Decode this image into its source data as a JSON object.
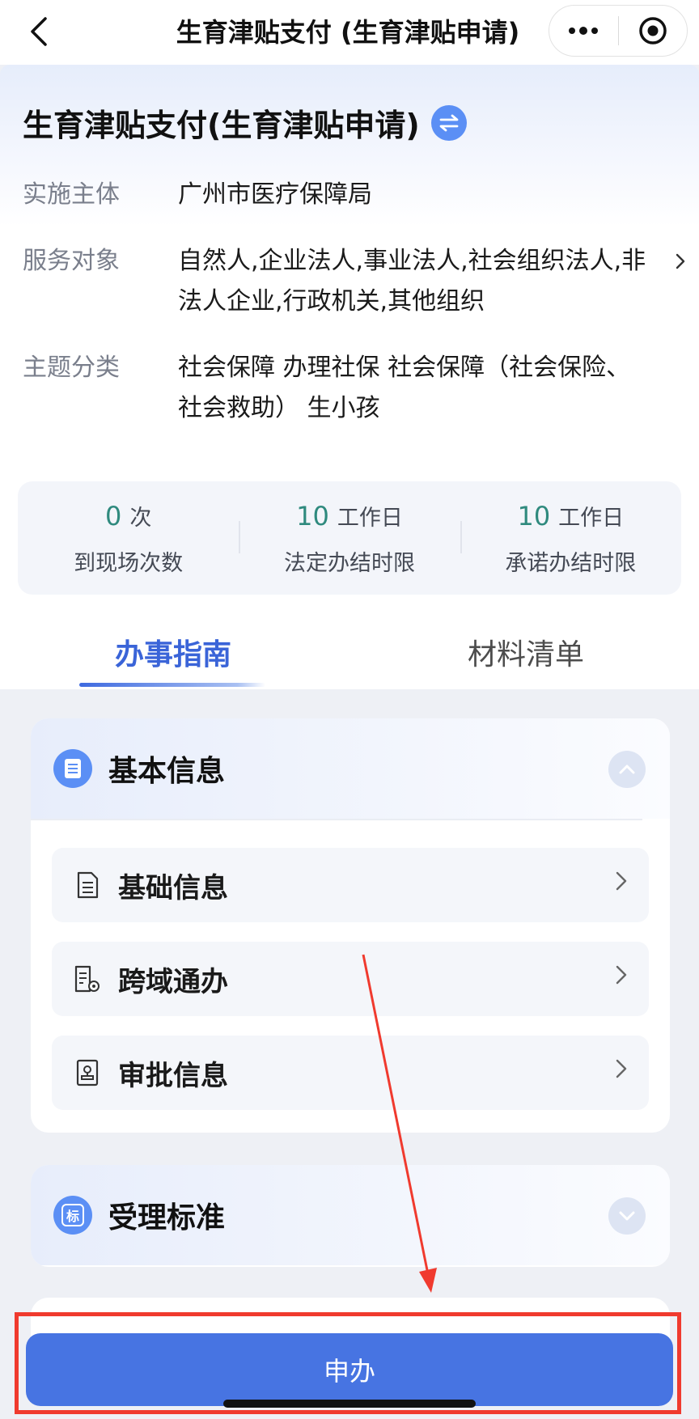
{
  "navbar": {
    "title": "生育津贴支付 (生育津贴申请)"
  },
  "service": {
    "title": "生育津贴支付(生育津贴申请)",
    "rows": [
      {
        "label": "实施主体",
        "value": "广州市医疗保障局"
      },
      {
        "label": "服务对象",
        "value": "自然人,企业法人,事业法人,社会组织法人,非法人企业,行政机关,其他组织"
      },
      {
        "label": "主题分类",
        "value": "社会保障 办理社保 社会保障（社会保险、社会救助） 生小孩"
      }
    ],
    "stats": [
      {
        "number": "0",
        "unit": "次",
        "label": "到现场次数"
      },
      {
        "number": "10",
        "unit": "工作日",
        "label": "法定办结时限"
      },
      {
        "number": "10",
        "unit": "工作日",
        "label": "承诺办结时限"
      }
    ]
  },
  "tabs": [
    {
      "label": "办事指南",
      "active": true
    },
    {
      "label": "材料清单",
      "active": false
    }
  ],
  "sections": {
    "basic": {
      "title": "基本信息",
      "items": [
        {
          "label": "基础信息",
          "icon": "document-icon"
        },
        {
          "label": "跨域通办",
          "icon": "document-location-icon"
        },
        {
          "label": "审批信息",
          "icon": "stamp-icon"
        }
      ]
    },
    "acceptance": {
      "title": "受理标准",
      "icon_text": "标"
    }
  },
  "apply_button": {
    "label": "申办"
  },
  "colors": {
    "primary": "#4774e2",
    "accent_green": "#2f8a7e",
    "annotation_red": "#f03a2e"
  }
}
